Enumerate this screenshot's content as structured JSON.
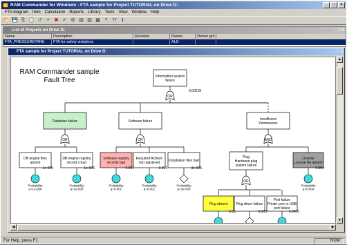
{
  "window": {
    "title": "RAM Commander for Windows - FTA sample for Project TUTORIAL on Drive D:"
  },
  "menu": [
    "FTA diagram",
    "Item",
    "Calculation",
    "Reports",
    "Library",
    "Tools",
    "View",
    "Window",
    "Help"
  ],
  "toolbar": [
    "open-icon",
    "save-icon",
    "copy-icon",
    "paste-icon",
    "undo-icon",
    "add-icon",
    "delete-icon",
    "check-icon",
    "calc-icon",
    "report-icon",
    "chart-icon",
    "lib-icon",
    "help-icon",
    "whatsthis-icon",
    "info-icon"
  ],
  "project_list": {
    "title": "List of Projects on Drive D:",
    "columns": [
      "Name",
      "Description",
      "Revision",
      "Owner",
      "Owner gro"
    ],
    "rows": [
      {
        "name": "FTA_PRESSURETANK",
        "description": "FTA for safety violations",
        "revision": "",
        "owner": "ALD",
        "owner_group": ""
      }
    ]
  },
  "fta_window": {
    "title": "FTA sample for Project TUTORIAL on Drive D:"
  },
  "diagram": {
    "heading": "RAM Commander sample\nFault Tree",
    "top_event": {
      "label": "Information system\nfailure",
      "value": "0.00218"
    },
    "top_gate": "OR",
    "level2": [
      {
        "label": "Database failure",
        "gate": "OR"
      },
      {
        "label": "Software failure",
        "gate": "OR"
      },
      {
        "label": "Insufficient\nPermissions",
        "gate": "AND"
      }
    ],
    "leaves": [
      {
        "label": "DB engine files\nabsent",
        "value": "1e-006",
        "prob": "Probability\nq=1e-006"
      },
      {
        "label": "DB engine registry\nrecord s bad",
        "value": "1e-006",
        "prob": "Probability\nq=1e-006"
      },
      {
        "label": "Software registry\nrecords bad",
        "value": "0.001",
        "prob": "Probability\nq=0.001"
      },
      {
        "label": "Required ActiveX\nnot registered",
        "value": "0.001",
        "prob": "Probability\nq=0.001"
      },
      {
        "label": "Installation files bad",
        "value": "3e-005",
        "prob": "Probability\nq=3e-005"
      },
      {
        "label": "License\nLicense file absent",
        "value": "0.004",
        "prob": "Probability\nq=0.004"
      }
    ],
    "plug": {
      "label": "Plug\nHardware plug\nsystem failure",
      "gate": "OR"
    },
    "plug_children": [
      {
        "label": "Plug absent",
        "value": "0.03"
      },
      {
        "label": "Plug driver failure",
        "value": "0.008"
      },
      {
        "label": "Port failure\nPrinter port or USB\nport failure",
        "value": "0.0005"
      }
    ]
  },
  "colors": {
    "green": "#c8f0c8",
    "pink": "#ffb0b0",
    "yellow": "#ffff40",
    "gray": "#a0a0a0",
    "cyan": "#40d8e0"
  },
  "status": {
    "text": "For Help, press F1",
    "num": "NUM"
  }
}
